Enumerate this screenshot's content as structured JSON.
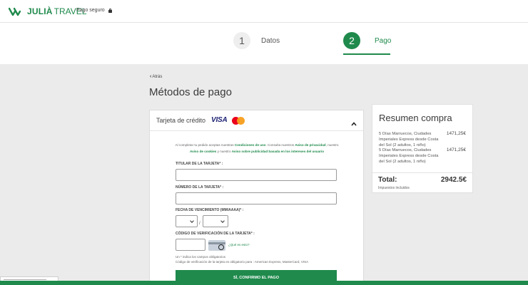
{
  "header": {
    "brand": "JULIÀ",
    "brand_suffix": "TRAVEL",
    "secure_label": "Pago seguro",
    "lock_icon": "lock-icon"
  },
  "steps": [
    {
      "number": "1",
      "label": "Datos",
      "active": false
    },
    {
      "number": "2",
      "label": "Pago",
      "active": true
    }
  ],
  "main": {
    "back_label": "Atrás",
    "title": "Métodos de pago",
    "payment": {
      "method_label": "Tarjeta de crédito",
      "visa_label": "VISA",
      "legal_text_1": "Al completar tu pedido aceptas nuestras ",
      "legal_link_1": "Condiciones de uso",
      "legal_text_2": ". Consulta nuestros ",
      "legal_link_2": "Aviso de privacidad",
      "legal_text_3": ", nuestro ",
      "legal_link_3": "Aviso de cookies",
      "legal_text_4": " y nuestro ",
      "legal_link_4": "Aviso sobre publicidad basada en los intereses del usuario",
      "holder_label": "TITULAR DE LA TARJETA* :",
      "holder_value": "",
      "number_label": "NÚMERO DE LA TARJETA* :",
      "number_value": "",
      "expiry_label": "FECHA DE VENCIMIENTO (MM/AAAA)* :",
      "expiry_separator": "/",
      "cvv_label": "CÓDIGO DE VERIFICACIÓN DE LA TARJETA* :",
      "cvv_help": "¿Qué es esto?",
      "note_required": "Un * indica los campos obligatorios",
      "note_cvv": "Código de verificación de la tarjeta es obligatorio para : American Express, MasterCard, VISA",
      "confirm_label": "SÍ, CONFIRMO EL PAGO"
    }
  },
  "summary": {
    "title": "Resumen compra",
    "items": [
      {
        "description": "5 Días Marruecos, Ciudades Imperiales Express desde Costa del Sol (2 adultos, 1 niño)",
        "price": "1471,25€"
      },
      {
        "description": "5 Días Marruecos, Ciudades Imperiales Express desde Costa del Sol (2 adultos, 1 niño)",
        "price": "1471,25€"
      }
    ],
    "total_label": "Total:",
    "taxes_label": "Impuestos incluidos",
    "total_value": "2942.5€"
  },
  "colors": {
    "brand_green": "#1f8a4c",
    "page_background": "#ebebeb"
  }
}
